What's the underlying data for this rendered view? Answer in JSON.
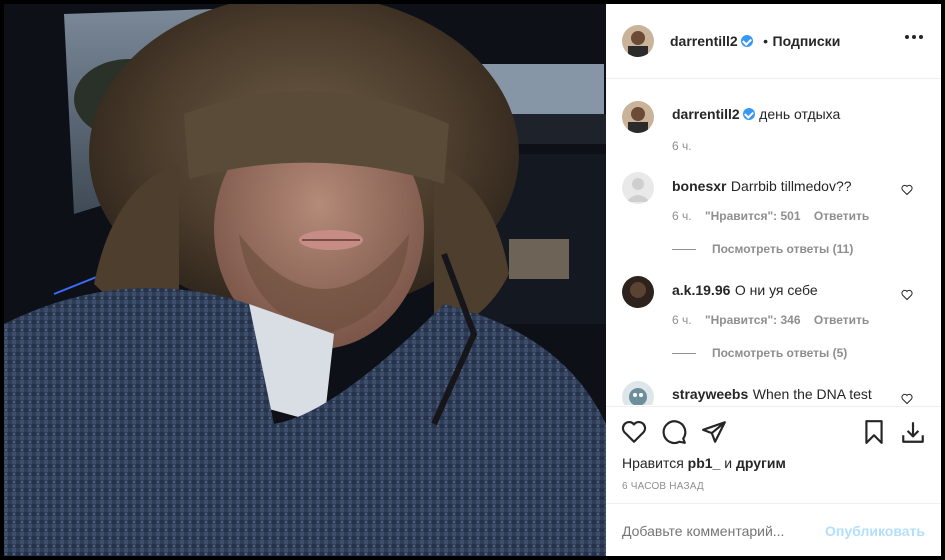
{
  "post": {
    "username": "darrentill2",
    "follow_separator": "•",
    "following_label": "Подписки",
    "caption_username": "darrentill2",
    "caption_text": "день отдыха",
    "caption_time": "6 ч."
  },
  "comments": [
    {
      "username": "bonesxr",
      "text": "Darrbib tillmedov??",
      "time": "6 ч.",
      "likes": "\"Нравится\": 501",
      "reply": "Ответить",
      "view_replies": "Посмотреть ответы (11)"
    },
    {
      "username": "a.k.19.96",
      "text": "О ни  уя себе",
      "time": "6 ч.",
      "likes": "\"Нравится\": 346",
      "reply": "Ответить",
      "view_replies": "Посмотреть ответы (5)"
    },
    {
      "username": "strayweebs",
      "text": "When the DNA test"
    }
  ],
  "likes_line": {
    "prefix": "Нравится",
    "user": "pb1_",
    "middle": "и",
    "others": "другим"
  },
  "timestamp": "6 ЧАСОВ НАЗАД",
  "add_comment": {
    "placeholder": "Добавьте комментарий...",
    "publish": "Опубликовать"
  },
  "colors": {
    "verified": "#3897f0",
    "publish": "#b2dffc",
    "muted": "#8e8e8e",
    "text": "#262626"
  },
  "icons": [
    "more-icon",
    "verified-icon",
    "heart-icon",
    "comment-icon",
    "share-icon",
    "bookmark-icon",
    "download-icon"
  ]
}
